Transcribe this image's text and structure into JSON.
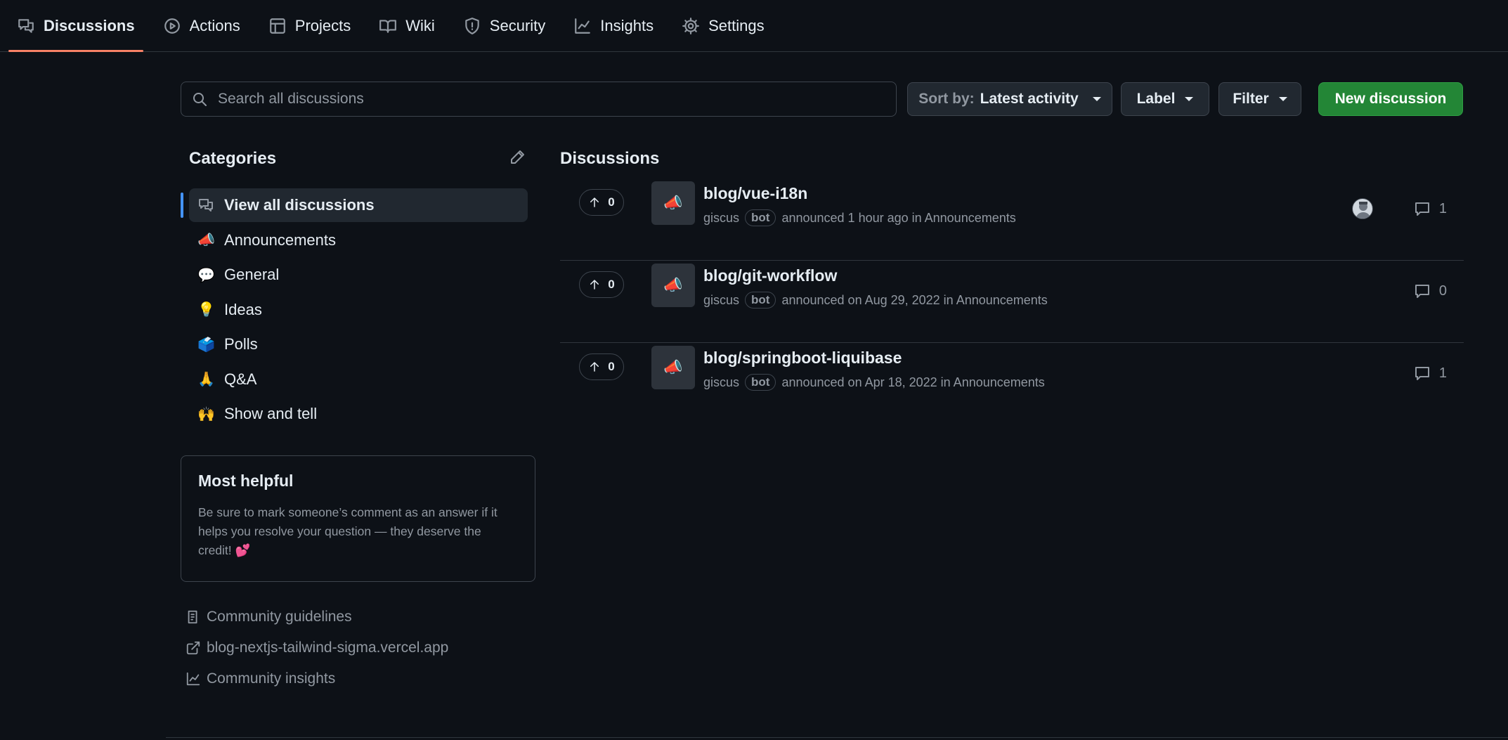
{
  "nav": {
    "tabs": [
      {
        "label": "Discussions",
        "icon": "comment-discussion-icon",
        "active": true
      },
      {
        "label": "Actions",
        "icon": "play-icon"
      },
      {
        "label": "Projects",
        "icon": "table-icon"
      },
      {
        "label": "Wiki",
        "icon": "book-icon"
      },
      {
        "label": "Security",
        "icon": "shield-icon"
      },
      {
        "label": "Insights",
        "icon": "graph-icon"
      },
      {
        "label": "Settings",
        "icon": "gear-icon"
      }
    ]
  },
  "toolbar": {
    "search_placeholder": "Search all discussions",
    "sort_prefix": "Sort by:",
    "sort_value": "Latest activity",
    "label_button": "Label",
    "filter_button": "Filter",
    "new_discussion": "New discussion"
  },
  "sidebar": {
    "categories_title": "Categories",
    "categories": [
      {
        "emoji": "",
        "label": "View all discussions",
        "icon": "comment-discussion-icon",
        "active": true
      },
      {
        "emoji": "📣",
        "label": "Announcements"
      },
      {
        "emoji": "💬",
        "label": "General"
      },
      {
        "emoji": "💡",
        "label": "Ideas"
      },
      {
        "emoji": "🗳️",
        "label": "Polls"
      },
      {
        "emoji": "🙏",
        "label": "Q&A"
      },
      {
        "emoji": "🙌",
        "label": "Show and tell"
      }
    ],
    "most_helpful": {
      "title": "Most helpful",
      "text": "Be sure to mark someone’s comment as an answer if it helps you resolve your question — they deserve the credit! 💕"
    },
    "links": [
      {
        "label": "Community guidelines",
        "icon": "book-guidelines-icon"
      },
      {
        "label": "blog-nextjs-tailwind-sigma.vercel.app",
        "icon": "link-external-icon"
      },
      {
        "label": "Community insights",
        "icon": "graph-icon"
      }
    ]
  },
  "discussions": {
    "title": "Discussions",
    "items": [
      {
        "upvotes": "0",
        "emoji": "📣",
        "title": "blog/vue-i18n",
        "author": "giscus",
        "badge": "bot",
        "meta": "announced 1 hour ago in Announcements",
        "comments": "1",
        "has_avatar": true
      },
      {
        "upvotes": "0",
        "emoji": "📣",
        "title": "blog/git-workflow",
        "author": "giscus",
        "badge": "bot",
        "meta": "announced on Aug 29, 2022 in Announcements",
        "comments": "0",
        "has_avatar": false
      },
      {
        "upvotes": "0",
        "emoji": "📣",
        "title": "blog/springboot-liquibase",
        "author": "giscus",
        "badge": "bot",
        "meta": "announced on Apr 18, 2022 in Announcements",
        "comments": "1",
        "has_avatar": false
      }
    ]
  },
  "colors": {
    "background": "#0d1117",
    "border": "#30363d",
    "active_tab_underline": "#f78166",
    "active_category_marker": "#4493f8",
    "primary_button": "#238636",
    "muted_text": "#9198a1"
  }
}
